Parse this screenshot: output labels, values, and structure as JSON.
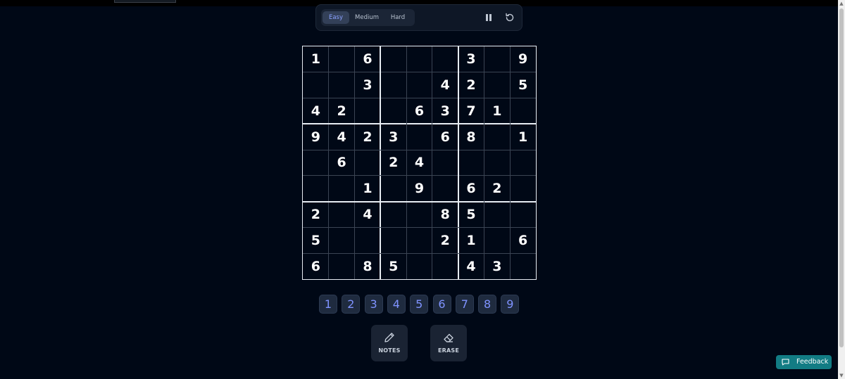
{
  "difficulty": {
    "options": [
      "Easy",
      "Medium",
      "Hard"
    ],
    "selected": "Easy"
  },
  "board": {
    "rows": [
      [
        1,
        0,
        6,
        0,
        0,
        0,
        3,
        0,
        9
      ],
      [
        0,
        0,
        3,
        0,
        0,
        4,
        2,
        0,
        5
      ],
      [
        4,
        2,
        0,
        0,
        6,
        3,
        7,
        1,
        0
      ],
      [
        9,
        4,
        2,
        3,
        0,
        6,
        8,
        0,
        1
      ],
      [
        0,
        6,
        0,
        2,
        4,
        0,
        0,
        0,
        0
      ],
      [
        0,
        0,
        1,
        0,
        9,
        0,
        6,
        2,
        0
      ],
      [
        2,
        0,
        4,
        0,
        0,
        8,
        5,
        0,
        0
      ],
      [
        5,
        0,
        0,
        0,
        0,
        2,
        1,
        0,
        6
      ],
      [
        6,
        0,
        8,
        5,
        0,
        0,
        4,
        3,
        0
      ]
    ]
  },
  "numpad": {
    "numbers": [
      "1",
      "2",
      "3",
      "4",
      "5",
      "6",
      "7",
      "8",
      "9"
    ]
  },
  "tools": {
    "notes_label": "NOTES",
    "erase_label": "ERASE"
  },
  "feedback": {
    "label": "Feedback"
  },
  "colors": {
    "background": "#000816",
    "accent": "#7f93ff",
    "feedback": "#127c84",
    "grid_line": "#3b4453",
    "grid_border": "#e8edf3"
  },
  "icons": {
    "pause": "pause-icon",
    "restart": "restart-icon",
    "notes": "pencil-icon",
    "erase": "eraser-icon",
    "feedback": "chat-icon"
  }
}
